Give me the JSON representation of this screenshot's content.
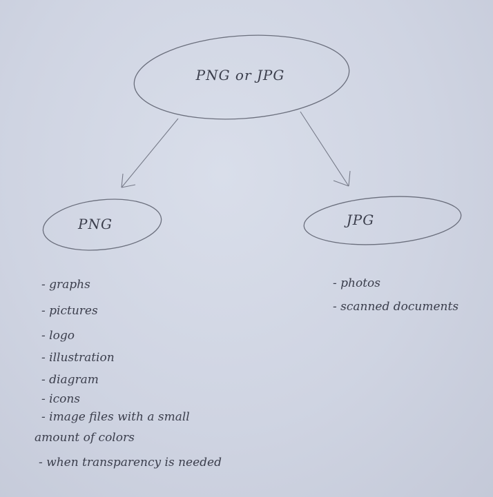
{
  "nodes": {
    "root": {
      "label": "PNG or JPG"
    },
    "left": {
      "label": "PNG"
    },
    "right": {
      "label": "JPG"
    }
  },
  "png_list": [
    "- graphs",
    "- pictures",
    "- logo",
    "- illustration",
    "- diagram",
    "- icons",
    "- image files with a small",
    "amount of colors",
    "- when transparency is needed"
  ],
  "jpg_list": [
    "- photos",
    "- scanned documents"
  ],
  "colors": {
    "paper": "#cfd4e2",
    "ink": "#3b3e4c",
    "pencil": "#6a6e7c"
  }
}
